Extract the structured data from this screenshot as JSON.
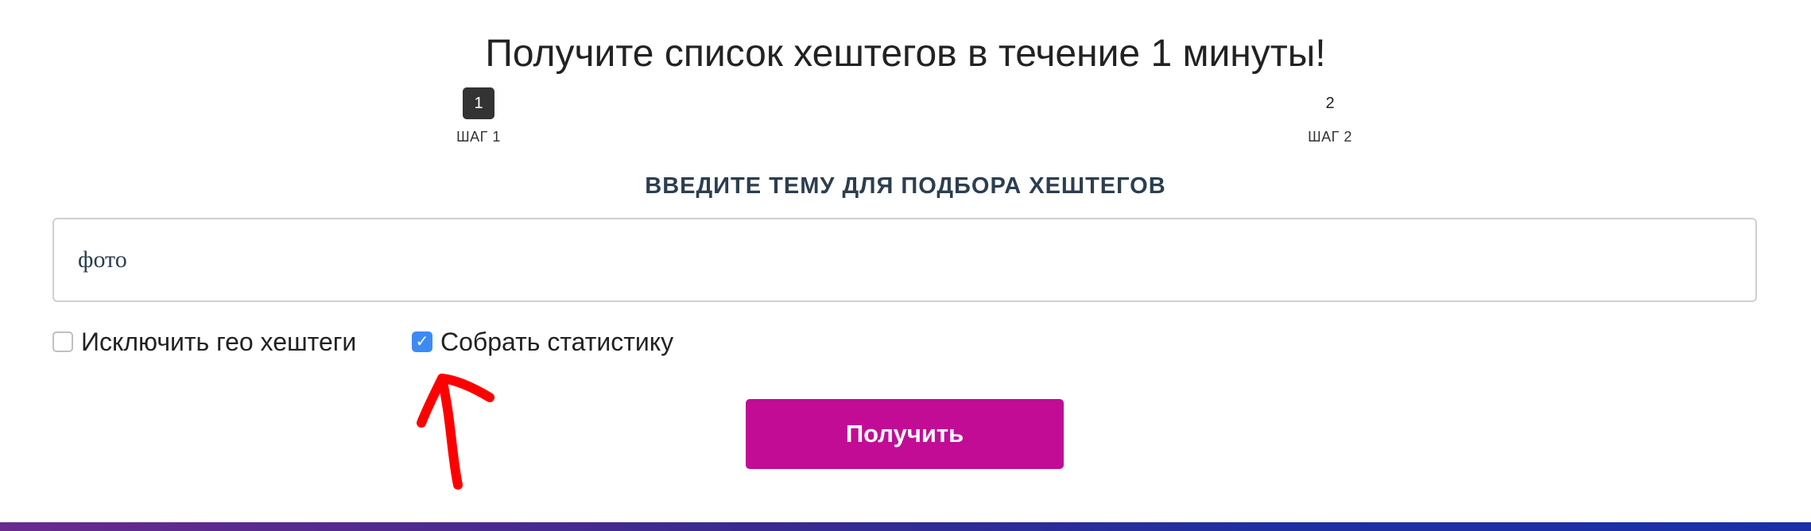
{
  "page": {
    "title": "Получите список хештегов в течение 1 минуты!"
  },
  "steps": [
    {
      "number": "1",
      "label": "ШАГ 1",
      "active": true
    },
    {
      "number": "2",
      "label": "ШАГ 2",
      "active": false
    }
  ],
  "form": {
    "heading": "ВВЕДИТЕ ТЕМУ ДЛЯ ПОДБОРА ХЕШТЕГОВ",
    "topic_value": "фото",
    "exclude_geo": {
      "label": "Исключить гео хештеги",
      "checked": false
    },
    "collect_stats": {
      "label": "Собрать статистику",
      "checked": true
    },
    "submit_label": "Получить"
  },
  "colors": {
    "button": "#c20c96",
    "checkbox_checked": "#3d8bf2",
    "heading": "#2c3e50",
    "annotation": "#ff0000"
  },
  "icons": {
    "check": "checkmark-icon",
    "annotation": "red-arrow-annotation"
  }
}
